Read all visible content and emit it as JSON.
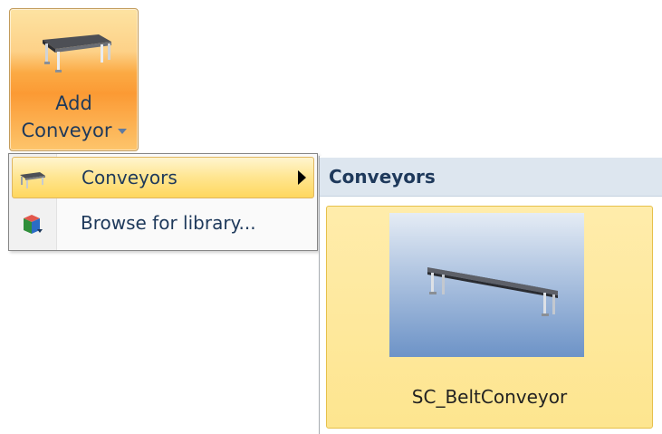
{
  "ribbon_button": {
    "label_line1": "Add",
    "label_line2": "Conveyor",
    "icon": "conveyor-icon"
  },
  "menu": {
    "items": [
      {
        "label": "Conveyors",
        "icon": "conveyor-icon",
        "has_submenu": true,
        "highlighted": true
      },
      {
        "label": "Browse for library...",
        "icon": "library-cube-icon",
        "has_submenu": false,
        "highlighted": false
      }
    ]
  },
  "gallery": {
    "header": "Conveyors",
    "items": [
      {
        "label": "SC_BeltConveyor",
        "icon": "belt-conveyor-thumbnail"
      }
    ]
  },
  "colors": {
    "ribbon_active": "#fb9a34",
    "menu_highlight": "#ffe58f",
    "gallery_header": "#dde6ef",
    "text": "#1e395b"
  }
}
